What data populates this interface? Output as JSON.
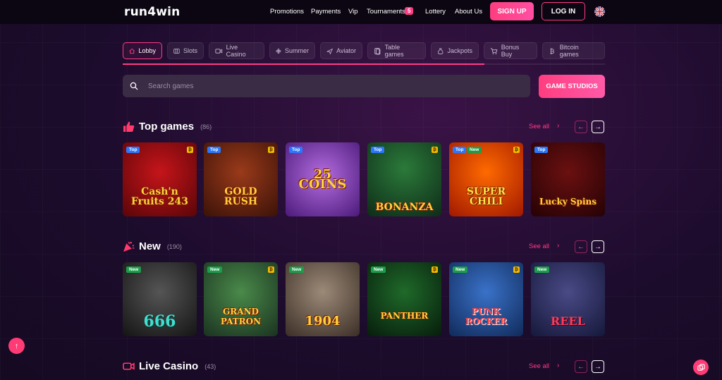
{
  "header": {
    "logo": "run4win",
    "nav": [
      "Promotions",
      "Payments",
      "Vip",
      "Tournaments",
      "Lottery",
      "About Us"
    ],
    "tournaments_badge": "5",
    "signup_label": "SIGN UP",
    "login_label": "LOG IN"
  },
  "categories": [
    "Lobby",
    "Slots",
    "Live Casino",
    "Summer",
    "Aviator",
    "Table games",
    "Jackpots",
    "Bonus Buy",
    "Bitcoin games"
  ],
  "category_scroll_fraction": 0.75,
  "search": {
    "placeholder": "Search games"
  },
  "studios_label": "GAME STUDIOS",
  "see_all_label": "See all",
  "sections": [
    {
      "title": "Top games",
      "count": "(86)",
      "games": [
        {
          "title": "Cash'n Fruits 243",
          "tag": "Top"
        },
        {
          "title": "GOLD RUSH",
          "tag": "Top"
        },
        {
          "title": "25 COINS",
          "tag": "Top"
        },
        {
          "title": "BONANZA",
          "tag": "Top"
        },
        {
          "title": "SUPER CHILI",
          "tag": "Top",
          "tag2": "New"
        },
        {
          "title": "Lucky Spins",
          "tag": "Top"
        }
      ]
    },
    {
      "title": "New",
      "count": "(190)",
      "games": [
        {
          "title": "666",
          "tag": "New"
        },
        {
          "title": "GRAND PATRON",
          "tag": "New"
        },
        {
          "title": "1904",
          "tag": "New"
        },
        {
          "title": "PANTHER",
          "tag": "New"
        },
        {
          "title": "PUNK ROCKER",
          "tag": "New"
        },
        {
          "title": "REEL",
          "tag": "New"
        }
      ]
    },
    {
      "title": "Live Casino",
      "count": "(43)",
      "games": []
    }
  ],
  "colors": {
    "accent": "#ff3b86",
    "background": "#1c0c2c",
    "topbar": "#0b0611"
  }
}
